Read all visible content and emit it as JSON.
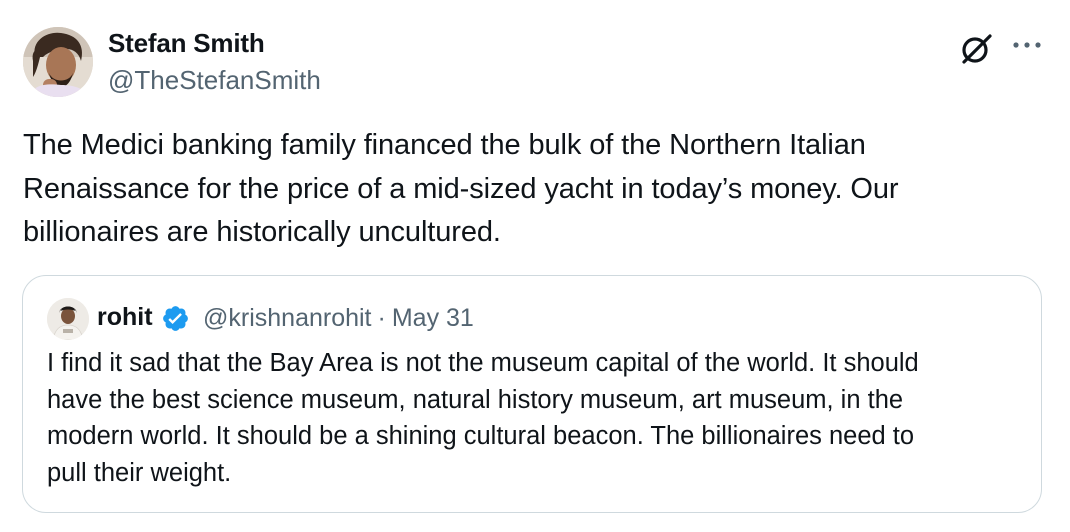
{
  "tweet": {
    "author": {
      "name": "Stefan Smith",
      "handle": "@TheStefanSmith"
    },
    "text": "The Medici banking family financed the bulk of the Northern Italian\nRenaissance for the price of a mid-sized yacht in today’s money. Our\nbillionaires are historically uncultured."
  },
  "quote": {
    "author": {
      "name": "rohit",
      "handle": "@krishnanrohit",
      "separator": "·",
      "date": "May 31",
      "verified": true
    },
    "text": "I find it sad that the Bay Area is not the museum capital of the world. It should\nhave the best science museum, natural history museum, art museum, in the\nmodern world. It should be a shining cultural beacon. The billionaires need to\npull their weight."
  },
  "icons": {
    "grok": "grok-icon",
    "more": "more-icon",
    "verified": "verified-badge-icon"
  },
  "colors": {
    "text": "#0f1419",
    "secondary": "#536471",
    "border": "#cfd9de",
    "verified": "#1d9bf0"
  }
}
